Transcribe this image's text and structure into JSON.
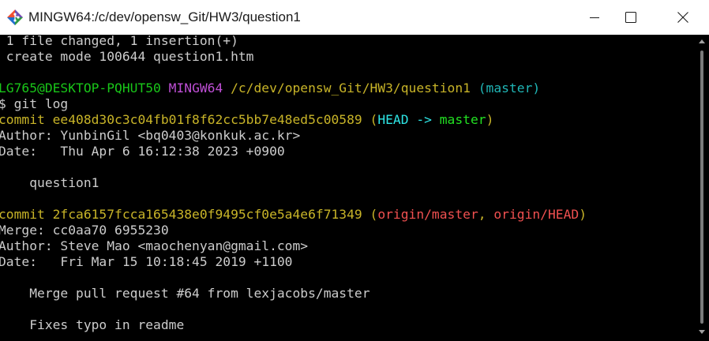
{
  "window": {
    "title": "MINGW64:/c/dev/opensw_Git/HW3/question1",
    "minimize_icon": "minimize-icon",
    "maximize_icon": "maximize-icon",
    "close_icon": "close-icon",
    "app_icon": "git-bash-icon"
  },
  "colors": {
    "prompt_user": "#19c619",
    "prompt_mingw": "#bf4fd6",
    "prompt_path": "#c8b428",
    "prompt_branch": "#20b6b6",
    "commit": "#c8b428",
    "head": "#2ee6e6",
    "branch_local": "#22e022",
    "branch_remote": "#f05050",
    "text": "#cccccc"
  },
  "terminal": {
    "lines": [
      [
        {
          "t": " 1 file changed, 1 insertion(+)",
          "c": "default"
        }
      ],
      [
        {
          "t": " create mode 100644 question1.htm",
          "c": "default"
        }
      ],
      [
        {
          "t": "",
          "c": "default"
        }
      ],
      [
        {
          "t": "LG765@DESKTOP-PQHUT50 ",
          "c": "green"
        },
        {
          "t": "MINGW64 ",
          "c": "magenta"
        },
        {
          "t": "/c/dev/opensw_Git/HW3/question1",
          "c": "yellow"
        },
        {
          "t": " (master)",
          "c": "cyan"
        }
      ],
      [
        {
          "t": "$ git log",
          "c": "default"
        }
      ],
      [
        {
          "t": "commit ee408d30c3c04fb01f8f62cc5bb7e48ed5c00589 (",
          "c": "yellow"
        },
        {
          "t": "HEAD -> ",
          "c": "brightcyan"
        },
        {
          "t": "master",
          "c": "brightgreen"
        },
        {
          "t": ")",
          "c": "yellow"
        }
      ],
      [
        {
          "t": "Author: YunbinGil <bq0403@konkuk.ac.kr>",
          "c": "default"
        }
      ],
      [
        {
          "t": "Date:   Thu Apr 6 16:12:38 2023 +0900",
          "c": "default"
        }
      ],
      [
        {
          "t": "",
          "c": "default"
        }
      ],
      [
        {
          "t": "    question1",
          "c": "default"
        }
      ],
      [
        {
          "t": "",
          "c": "default"
        }
      ],
      [
        {
          "t": "commit 2fca6157fcca165438e0f9495cf0e5a4e6f71349 (",
          "c": "yellow"
        },
        {
          "t": "origin/master",
          "c": "red"
        },
        {
          "t": ", ",
          "c": "yellow"
        },
        {
          "t": "origin/HEAD",
          "c": "red"
        },
        {
          "t": ")",
          "c": "yellow"
        }
      ],
      [
        {
          "t": "Merge: cc0aa70 6955230",
          "c": "default"
        }
      ],
      [
        {
          "t": "Author: Steve Mao <maochenyan@gmail.com>",
          "c": "default"
        }
      ],
      [
        {
          "t": "Date:   Fri Mar 15 10:18:45 2019 +1100",
          "c": "default"
        }
      ],
      [
        {
          "t": "",
          "c": "default"
        }
      ],
      [
        {
          "t": "    Merge pull request #64 from lexjacobs/master",
          "c": "default"
        }
      ],
      [
        {
          "t": "",
          "c": "default"
        }
      ],
      [
        {
          "t": "    Fixes typo in readme",
          "c": "default"
        }
      ]
    ]
  }
}
